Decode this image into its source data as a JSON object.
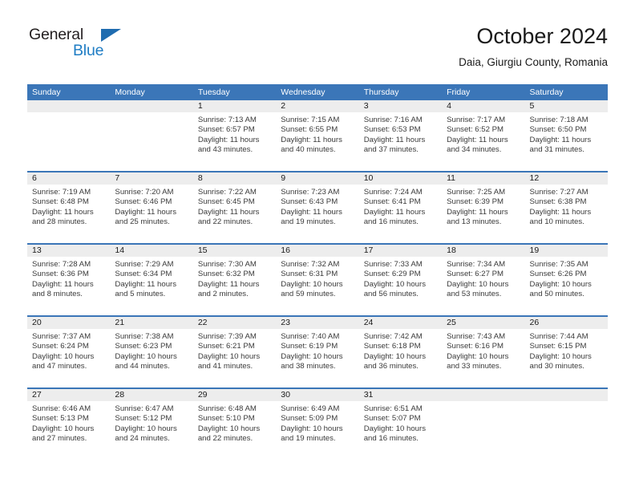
{
  "brand": {
    "name_part1": "General",
    "name_part2": "Blue",
    "triangle_color": "#1f6cb0",
    "blue_color": "#1f7dc4"
  },
  "header": {
    "title": "October 2024",
    "subtitle": "Daia, Giurgiu County, Romania"
  },
  "theme": {
    "header_blue": "#3b76b8",
    "daynum_band": "#ededed",
    "text": "#1a1a1a",
    "cell_text": "#3a3a3a"
  },
  "weekdays": [
    "Sunday",
    "Monday",
    "Tuesday",
    "Wednesday",
    "Thursday",
    "Friday",
    "Saturday"
  ],
  "weeks": [
    {
      "days": [
        {
          "num": "",
          "lines": []
        },
        {
          "num": "",
          "lines": []
        },
        {
          "num": "1",
          "lines": [
            "Sunrise: 7:13 AM",
            "Sunset: 6:57 PM",
            "Daylight: 11 hours and 43 minutes."
          ]
        },
        {
          "num": "2",
          "lines": [
            "Sunrise: 7:15 AM",
            "Sunset: 6:55 PM",
            "Daylight: 11 hours and 40 minutes."
          ]
        },
        {
          "num": "3",
          "lines": [
            "Sunrise: 7:16 AM",
            "Sunset: 6:53 PM",
            "Daylight: 11 hours and 37 minutes."
          ]
        },
        {
          "num": "4",
          "lines": [
            "Sunrise: 7:17 AM",
            "Sunset: 6:52 PM",
            "Daylight: 11 hours and 34 minutes."
          ]
        },
        {
          "num": "5",
          "lines": [
            "Sunrise: 7:18 AM",
            "Sunset: 6:50 PM",
            "Daylight: 11 hours and 31 minutes."
          ]
        }
      ]
    },
    {
      "days": [
        {
          "num": "6",
          "lines": [
            "Sunrise: 7:19 AM",
            "Sunset: 6:48 PM",
            "Daylight: 11 hours and 28 minutes."
          ]
        },
        {
          "num": "7",
          "lines": [
            "Sunrise: 7:20 AM",
            "Sunset: 6:46 PM",
            "Daylight: 11 hours and 25 minutes."
          ]
        },
        {
          "num": "8",
          "lines": [
            "Sunrise: 7:22 AM",
            "Sunset: 6:45 PM",
            "Daylight: 11 hours and 22 minutes."
          ]
        },
        {
          "num": "9",
          "lines": [
            "Sunrise: 7:23 AM",
            "Sunset: 6:43 PM",
            "Daylight: 11 hours and 19 minutes."
          ]
        },
        {
          "num": "10",
          "lines": [
            "Sunrise: 7:24 AM",
            "Sunset: 6:41 PM",
            "Daylight: 11 hours and 16 minutes."
          ]
        },
        {
          "num": "11",
          "lines": [
            "Sunrise: 7:25 AM",
            "Sunset: 6:39 PM",
            "Daylight: 11 hours and 13 minutes."
          ]
        },
        {
          "num": "12",
          "lines": [
            "Sunrise: 7:27 AM",
            "Sunset: 6:38 PM",
            "Daylight: 11 hours and 10 minutes."
          ]
        }
      ]
    },
    {
      "days": [
        {
          "num": "13",
          "lines": [
            "Sunrise: 7:28 AM",
            "Sunset: 6:36 PM",
            "Daylight: 11 hours and 8 minutes."
          ]
        },
        {
          "num": "14",
          "lines": [
            "Sunrise: 7:29 AM",
            "Sunset: 6:34 PM",
            "Daylight: 11 hours and 5 minutes."
          ]
        },
        {
          "num": "15",
          "lines": [
            "Sunrise: 7:30 AM",
            "Sunset: 6:32 PM",
            "Daylight: 11 hours and 2 minutes."
          ]
        },
        {
          "num": "16",
          "lines": [
            "Sunrise: 7:32 AM",
            "Sunset: 6:31 PM",
            "Daylight: 10 hours and 59 minutes."
          ]
        },
        {
          "num": "17",
          "lines": [
            "Sunrise: 7:33 AM",
            "Sunset: 6:29 PM",
            "Daylight: 10 hours and 56 minutes."
          ]
        },
        {
          "num": "18",
          "lines": [
            "Sunrise: 7:34 AM",
            "Sunset: 6:27 PM",
            "Daylight: 10 hours and 53 minutes."
          ]
        },
        {
          "num": "19",
          "lines": [
            "Sunrise: 7:35 AM",
            "Sunset: 6:26 PM",
            "Daylight: 10 hours and 50 minutes."
          ]
        }
      ]
    },
    {
      "days": [
        {
          "num": "20",
          "lines": [
            "Sunrise: 7:37 AM",
            "Sunset: 6:24 PM",
            "Daylight: 10 hours and 47 minutes."
          ]
        },
        {
          "num": "21",
          "lines": [
            "Sunrise: 7:38 AM",
            "Sunset: 6:23 PM",
            "Daylight: 10 hours and 44 minutes."
          ]
        },
        {
          "num": "22",
          "lines": [
            "Sunrise: 7:39 AM",
            "Sunset: 6:21 PM",
            "Daylight: 10 hours and 41 minutes."
          ]
        },
        {
          "num": "23",
          "lines": [
            "Sunrise: 7:40 AM",
            "Sunset: 6:19 PM",
            "Daylight: 10 hours and 38 minutes."
          ]
        },
        {
          "num": "24",
          "lines": [
            "Sunrise: 7:42 AM",
            "Sunset: 6:18 PM",
            "Daylight: 10 hours and 36 minutes."
          ]
        },
        {
          "num": "25",
          "lines": [
            "Sunrise: 7:43 AM",
            "Sunset: 6:16 PM",
            "Daylight: 10 hours and 33 minutes."
          ]
        },
        {
          "num": "26",
          "lines": [
            "Sunrise: 7:44 AM",
            "Sunset: 6:15 PM",
            "Daylight: 10 hours and 30 minutes."
          ]
        }
      ]
    },
    {
      "days": [
        {
          "num": "27",
          "lines": [
            "Sunrise: 6:46 AM",
            "Sunset: 5:13 PM",
            "Daylight: 10 hours and 27 minutes."
          ]
        },
        {
          "num": "28",
          "lines": [
            "Sunrise: 6:47 AM",
            "Sunset: 5:12 PM",
            "Daylight: 10 hours and 24 minutes."
          ]
        },
        {
          "num": "29",
          "lines": [
            "Sunrise: 6:48 AM",
            "Sunset: 5:10 PM",
            "Daylight: 10 hours and 22 minutes."
          ]
        },
        {
          "num": "30",
          "lines": [
            "Sunrise: 6:49 AM",
            "Sunset: 5:09 PM",
            "Daylight: 10 hours and 19 minutes."
          ]
        },
        {
          "num": "31",
          "lines": [
            "Sunrise: 6:51 AM",
            "Sunset: 5:07 PM",
            "Daylight: 10 hours and 16 minutes."
          ]
        },
        {
          "num": "",
          "lines": []
        },
        {
          "num": "",
          "lines": []
        }
      ]
    }
  ]
}
